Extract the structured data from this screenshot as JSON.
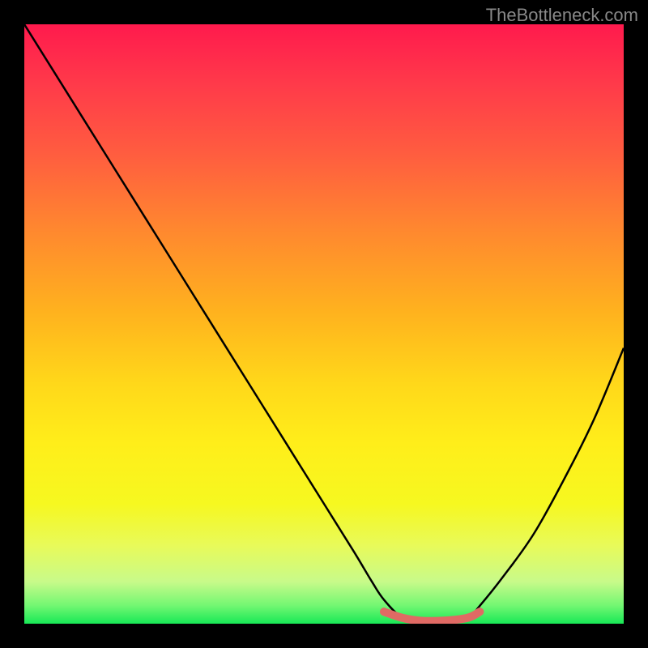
{
  "watermark": "TheBottleneck.com",
  "chart_data": {
    "type": "line",
    "title": "",
    "xlabel": "",
    "ylabel": "",
    "xlim": [
      0,
      100
    ],
    "ylim": [
      0,
      100
    ],
    "background_gradient": {
      "top": "#ff1a4d",
      "bottom": "#18e856",
      "description": "red-to-green vertical gradient (red high, green low)"
    },
    "series": [
      {
        "name": "bottleneck-curve",
        "description": "Black curve representing bottleneck percentage; descends steeply from top-left, reaches a flat minimum near x≈63–74, then rises toward the right.",
        "color": "#000000",
        "stroke_width": 2,
        "x": [
          0,
          5,
          10,
          15,
          20,
          25,
          30,
          35,
          40,
          45,
          50,
          55,
          58,
          60,
          63,
          66,
          70,
          74,
          76,
          80,
          85,
          90,
          95,
          100
        ],
        "values": [
          100,
          92,
          84,
          76,
          68,
          60,
          52,
          44,
          36,
          28,
          20,
          12,
          7,
          4,
          1,
          0,
          0,
          1,
          3,
          8,
          15,
          24,
          34,
          46
        ]
      },
      {
        "name": "flat-bottom-highlight",
        "description": "Thicker salmon-colored flat segment marking the minimum/optimal zone at the bottom of the curve.",
        "color": "#e06a64",
        "stroke_width": 8,
        "x": [
          60,
          63,
          66,
          70,
          74,
          76
        ],
        "values": [
          2,
          1,
          0.5,
          0.5,
          1,
          2
        ]
      }
    ]
  }
}
